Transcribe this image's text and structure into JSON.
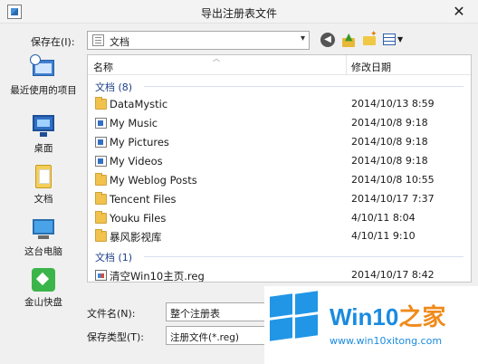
{
  "window": {
    "title": "导出注册表文件",
    "close_glyph": "✕"
  },
  "location": {
    "label": "保存在(I):",
    "value": "文档"
  },
  "places": [
    {
      "label": "最近使用的项目",
      "icon": "recent-places-icon"
    },
    {
      "label": "桌面",
      "icon": "desktop-icon"
    },
    {
      "label": "文档",
      "icon": "documents-icon"
    },
    {
      "label": "这台电脑",
      "icon": "this-pc-icon"
    },
    {
      "label": "金山快盘",
      "icon": "kuaipan-icon"
    }
  ],
  "columns": {
    "name": "名称",
    "date": "修改日期"
  },
  "groups": [
    {
      "label": "文档 (8)",
      "items": [
        {
          "name": "DataMystic",
          "date": "2014/10/13 8:59",
          "icon": "folder"
        },
        {
          "name": "My Music",
          "date": "2014/10/8 9:18",
          "icon": "special-folder"
        },
        {
          "name": "My Pictures",
          "date": "2014/10/8 9:18",
          "icon": "special-folder"
        },
        {
          "name": "My Videos",
          "date": "2014/10/8 9:18",
          "icon": "special-folder"
        },
        {
          "name": "My Weblog Posts",
          "date": "2014/10/8 10:55",
          "icon": "folder"
        },
        {
          "name": "Tencent Files",
          "date": "2014/10/17 7:37",
          "icon": "folder"
        },
        {
          "name": "Youku Files",
          "date": "4/10/11 8:04",
          "icon": "folder"
        },
        {
          "name": "暴风影视库",
          "date": "4/10/11 9:10",
          "icon": "folder"
        }
      ]
    },
    {
      "label": "文档 (1)",
      "items": [
        {
          "name": "清空Win10主页.reg",
          "date": "2014/10/17 8:42",
          "icon": "reg-file"
        }
      ]
    }
  ],
  "filename": {
    "label": "文件名(N):",
    "value": "整个注册表"
  },
  "filetype": {
    "label": "保存类型(T):",
    "value": "注册文件(*.reg)"
  },
  "watermark": {
    "brand": "Win10",
    "brand_cn": "之家",
    "url": "www.win10xitong.com",
    "faint_text": "WIN10XITONG.COM"
  }
}
